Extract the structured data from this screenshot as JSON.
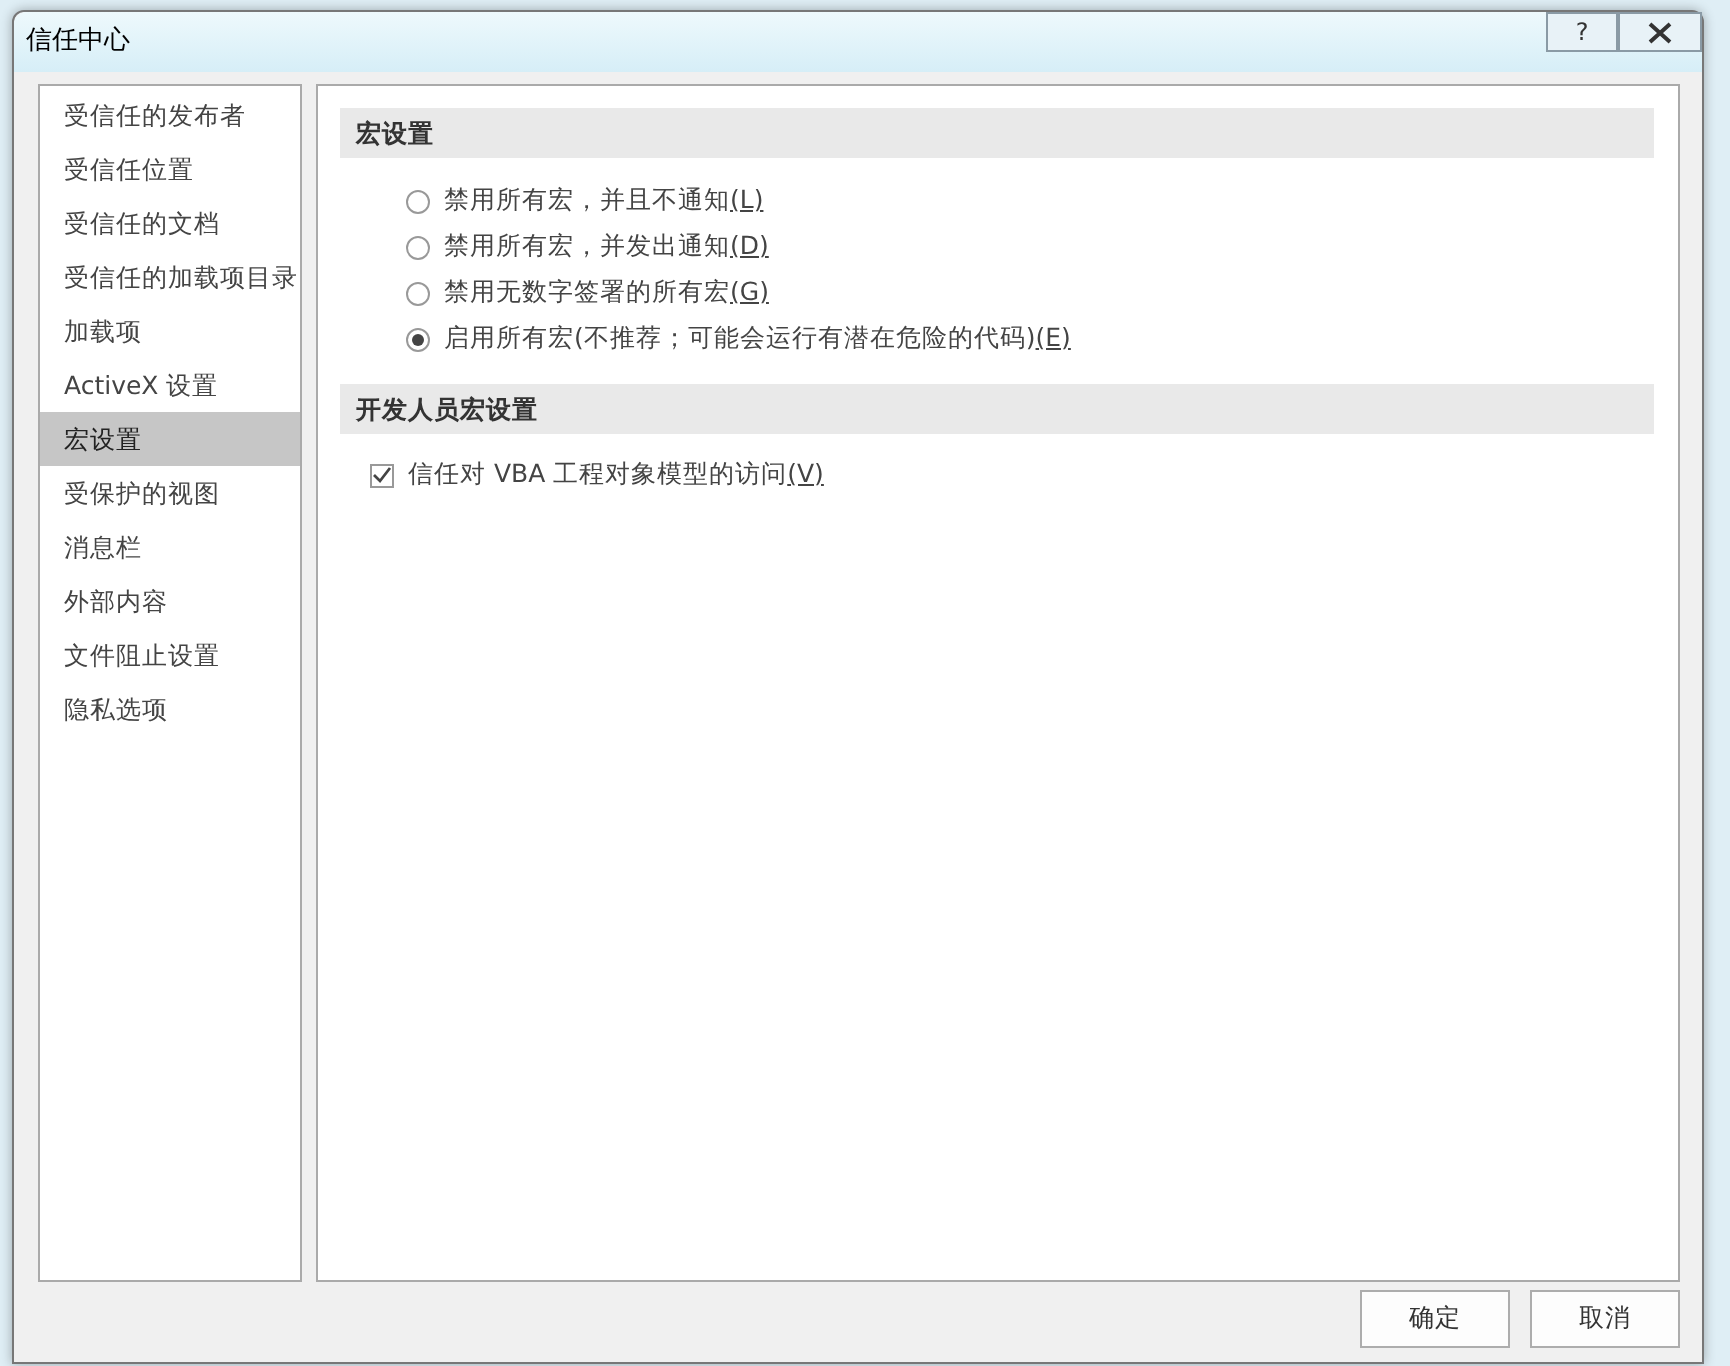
{
  "window": {
    "title": "信任中心",
    "help_button": "?"
  },
  "sidebar": {
    "items": [
      {
        "label": "受信任的发布者",
        "selected": false
      },
      {
        "label": "受信任位置",
        "selected": false
      },
      {
        "label": "受信任的文档",
        "selected": false
      },
      {
        "label": "受信任的加载项目录",
        "selected": false
      },
      {
        "label": "加载项",
        "selected": false
      },
      {
        "label": "ActiveX 设置",
        "selected": false
      },
      {
        "label": "宏设置",
        "selected": true
      },
      {
        "label": "受保护的视图",
        "selected": false
      },
      {
        "label": "消息栏",
        "selected": false
      },
      {
        "label": "外部内容",
        "selected": false
      },
      {
        "label": "文件阻止设置",
        "selected": false
      },
      {
        "label": "隐私选项",
        "selected": false
      }
    ]
  },
  "sections": [
    {
      "title": "宏设置",
      "options": [
        {
          "kind": "radio",
          "label": "禁用所有宏，并且不通知",
          "access_key": "(L)",
          "selected": false
        },
        {
          "kind": "radio",
          "label": "禁用所有宏，并发出通知",
          "access_key": "(D)",
          "selected": false
        },
        {
          "kind": "radio",
          "label": "禁用无数字签署的所有宏",
          "access_key": "(G)",
          "selected": false
        },
        {
          "kind": "radio",
          "label": "启用所有宏(不推荐；可能会运行有潜在危险的代码)",
          "access_key": "(E)",
          "selected": true
        }
      ]
    },
    {
      "title": "开发人员宏设置",
      "options": [
        {
          "kind": "checkbox",
          "label": "信任对 VBA 工程对象模型的访问",
          "access_key": "(V)",
          "checked": true
        }
      ]
    }
  ],
  "buttons": [
    "确定",
    "取消"
  ]
}
